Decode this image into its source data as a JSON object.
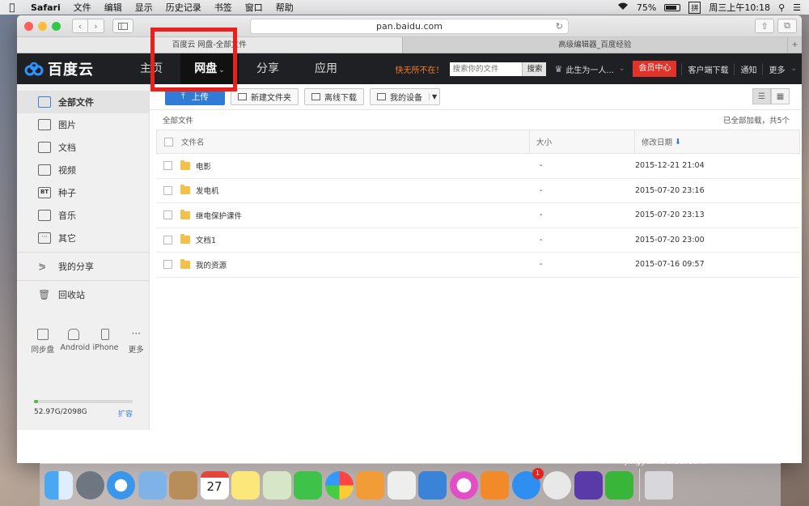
{
  "menubar": {
    "app": "Safari",
    "items": [
      "文件",
      "编辑",
      "显示",
      "历史记录",
      "书签",
      "窗口",
      "帮助"
    ],
    "battery": "75%",
    "input_method": "拼",
    "clock": "周三上午10:18"
  },
  "browser": {
    "url": "pan.baidu.com",
    "tabs": [
      {
        "title": "百度云 网盘-全部文件",
        "active": true
      },
      {
        "title": "高级编辑器_百度经验",
        "active": false
      }
    ],
    "new_tab": "+"
  },
  "header": {
    "logo": "百度云",
    "nav": [
      {
        "label": "主页",
        "active": false
      },
      {
        "label": "网盘",
        "active": true,
        "caret": "⌄"
      },
      {
        "label": "分享",
        "active": false
      },
      {
        "label": "应用",
        "active": false
      }
    ],
    "slogan": "快无所不在！",
    "search_placeholder": "搜索你的文件",
    "search_button": "搜索",
    "username": "此生为一人...",
    "vip": "会员中心",
    "links": [
      "客户端下载",
      "通知",
      "更多"
    ]
  },
  "sidebar": {
    "items": [
      {
        "label": "全部文件",
        "icon": "files-icon",
        "active": true
      },
      {
        "label": "图片",
        "icon": "image-icon"
      },
      {
        "label": "文档",
        "icon": "document-icon"
      },
      {
        "label": "视频",
        "icon": "video-icon"
      },
      {
        "label": "种子",
        "icon": "bt-icon"
      },
      {
        "label": "音乐",
        "icon": "music-icon"
      },
      {
        "label": "其它",
        "icon": "other-icon"
      }
    ],
    "share": "我的分享",
    "trash": "回收站",
    "devices": [
      "同步盘",
      "Android",
      "iPhone",
      "更多"
    ],
    "quota": {
      "used": "52.97G/2098G",
      "fraction": 0.025,
      "expand": "扩容"
    }
  },
  "toolbar": {
    "upload": "上传",
    "new_folder": "新建文件夹",
    "offline": "离线下载",
    "devices": "我的设备"
  },
  "list": {
    "breadcrumb": "全部文件",
    "status": "已全部加载，共5个",
    "headers": {
      "name": "文件名",
      "size": "大小",
      "date": "修改日期"
    },
    "rows": [
      {
        "name": "电影",
        "size": "-",
        "date": "2015-12-21 21:04"
      },
      {
        "name": "发电机",
        "size": "-",
        "date": "2015-07-20 23:16"
      },
      {
        "name": "继电保护课件",
        "size": "-",
        "date": "2015-07-20 23:13"
      },
      {
        "name": "文档1",
        "size": "-",
        "date": "2015-07-20 23:00"
      },
      {
        "name": "我的资源",
        "size": "-",
        "date": "2015-07-16 09:57"
      }
    ]
  },
  "dock": {
    "calendar_day": "27",
    "appstore_badge": "1"
  },
  "watermark": {
    "text": "Baidu经验",
    "sub": "jingyan.baidu.com"
  },
  "colors": {
    "accent": "#2f7bd6",
    "highlight": "#e8211c",
    "vip": "#e2332a",
    "slogan": "#f37c2b"
  }
}
